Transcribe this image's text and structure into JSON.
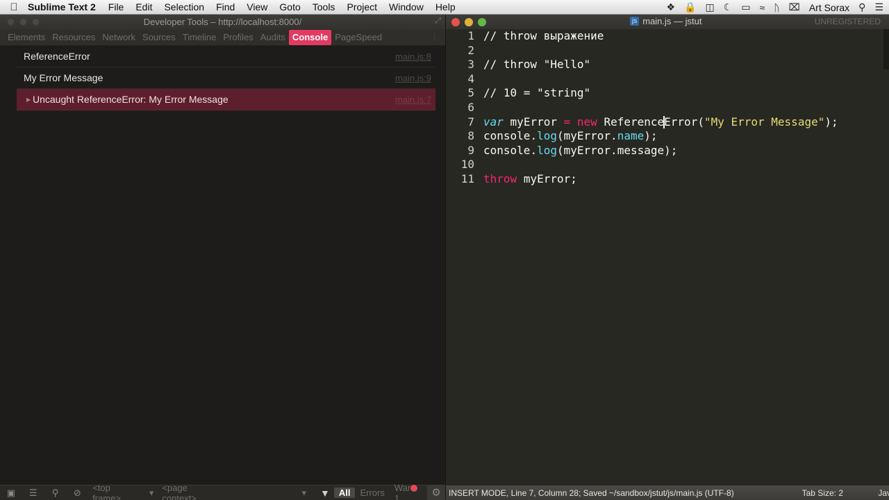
{
  "menubar": {
    "app_name": "Sublime Text 2",
    "items": [
      "File",
      "Edit",
      "Selection",
      "Find",
      "View",
      "Goto",
      "Tools",
      "Project",
      "Window",
      "Help"
    ],
    "user": "Art Sorax"
  },
  "devtools": {
    "window_title": "Developer Tools – http://localhost:8000/",
    "tabs": [
      "Elements",
      "Resources",
      "Network",
      "Sources",
      "Timeline",
      "Profiles",
      "Audits",
      "Console",
      "PageSpeed"
    ],
    "active_tab": "Console",
    "console": {
      "rows": [
        {
          "message": "ReferenceError",
          "source": "main.js:8",
          "type": "log"
        },
        {
          "message": "My Error Message",
          "source": "main.js:9",
          "type": "log"
        },
        {
          "message": "Uncaught ReferenceError: My Error Message",
          "source": "main.js:7",
          "type": "error"
        }
      ]
    },
    "bottom_bar": {
      "frame_select": "<top frame>",
      "context_select": "<page context>",
      "filters": [
        "All",
        "Errors",
        "Warnings"
      ],
      "active_filter": "All",
      "warnings_label": "War",
      "error_count": "1"
    }
  },
  "editor": {
    "window_title": "main.js — jstut",
    "file_badge": "js",
    "unregistered": "UNREGISTERED",
    "lines": [
      {
        "n": "1",
        "text": "// throw выражение"
      },
      {
        "n": "2",
        "text": ""
      },
      {
        "n": "3",
        "text": "// throw \"Hello\""
      },
      {
        "n": "4",
        "text": ""
      },
      {
        "n": "5",
        "text": "// 10 = \"string\""
      },
      {
        "n": "6",
        "text": ""
      },
      {
        "n": "7",
        "text": "var myError = new ReferenceError(\"My Error Message\");"
      },
      {
        "n": "8",
        "text": "console.log(myError.name);"
      },
      {
        "n": "9",
        "text": "console.log(myError.message);"
      },
      {
        "n": "10",
        "text": ""
      },
      {
        "n": "11",
        "text": "throw myError;"
      }
    ],
    "status": {
      "mode": "INSERT MODE, Line 7, Column 28; Saved ~/sandbox/jstut/js/main.js (UTF-8)",
      "tab_size": "Tab Size: 2",
      "syntax": "Jav"
    }
  },
  "colors": {
    "console_tab_active": "#e23b63",
    "error_row_bg": "#5d1f2c",
    "editor_bg": "#272822",
    "comment": "#75715e",
    "keyword": "#66d9ef",
    "operator": "#f92672",
    "string": "#e6db74"
  }
}
